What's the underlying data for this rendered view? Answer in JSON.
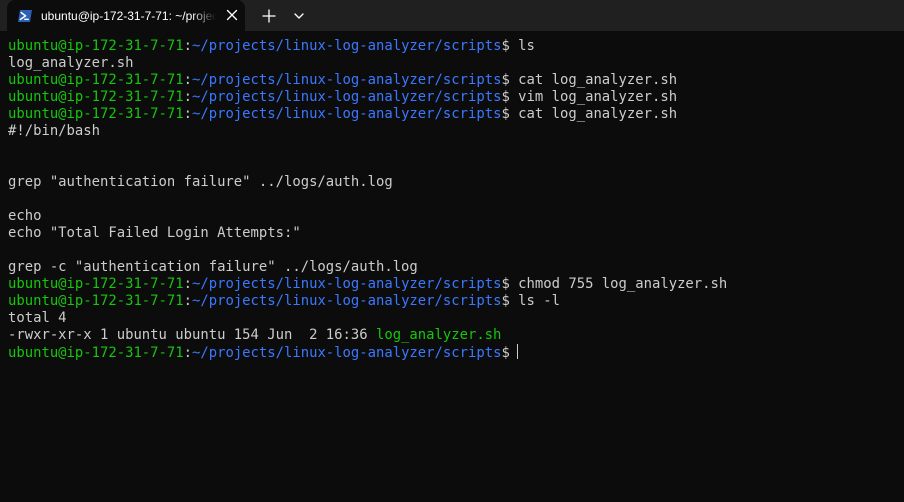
{
  "tab": {
    "title": "ubuntu@ip-172-31-7-71: ~/projects/linux-log-analyzer/scripts",
    "icon": "powershell-prompt-icon"
  },
  "prompt": {
    "user_host": "ubuntu@ip-172-31-7-71",
    "separator": ":",
    "path": "~/projects/linux-log-analyzer/scripts",
    "symbol": "$"
  },
  "lines": [
    {
      "type": "prompt",
      "command": " ls"
    },
    {
      "type": "output",
      "text": "log_analyzer.sh"
    },
    {
      "type": "prompt",
      "command": " cat log_analyzer.sh"
    },
    {
      "type": "prompt",
      "command": " vim log_analyzer.sh"
    },
    {
      "type": "prompt",
      "command": " cat log_analyzer.sh"
    },
    {
      "type": "output",
      "text": "#!/bin/bash"
    },
    {
      "type": "output",
      "text": ""
    },
    {
      "type": "output",
      "text": ""
    },
    {
      "type": "output",
      "text": "grep \"authentication failure\" ../logs/auth.log"
    },
    {
      "type": "output",
      "text": ""
    },
    {
      "type": "output",
      "text": "echo"
    },
    {
      "type": "output",
      "text": "echo \"Total Failed Login Attempts:\""
    },
    {
      "type": "output",
      "text": ""
    },
    {
      "type": "output",
      "text": "grep -c \"authentication failure\" ../logs/auth.log"
    },
    {
      "type": "prompt",
      "command": " chmod 755 log_analyzer.sh"
    },
    {
      "type": "prompt",
      "command": " ls -l"
    },
    {
      "type": "output",
      "text": "total 4"
    },
    {
      "type": "listing",
      "text": "-rwxr-xr-x 1 ubuntu ubuntu 154 Jun  2 16:36 ",
      "filename": "log_analyzer.sh"
    },
    {
      "type": "active_prompt",
      "command": " "
    }
  ],
  "colors": {
    "background": "#0c0c0c",
    "tabbar": "#202020",
    "user_host": "#16c60c",
    "path": "#3b78ff",
    "text": "#cccccc",
    "executable": "#16c60c"
  }
}
